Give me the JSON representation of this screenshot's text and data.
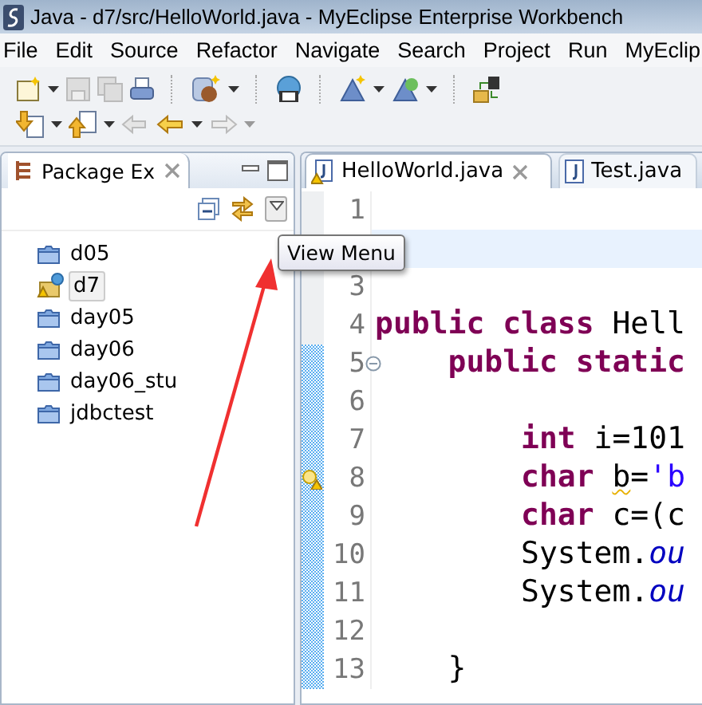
{
  "window": {
    "title": "Java - d7/src/HelloWorld.java - MyEclipse Enterprise Workbench"
  },
  "menu": [
    "File",
    "Edit",
    "Source",
    "Refactor",
    "Navigate",
    "Search",
    "Project",
    "Run",
    "MyEclip"
  ],
  "package_explorer": {
    "title": "Package Ex",
    "items": [
      {
        "label": "d05",
        "kind": "folder",
        "selected": false
      },
      {
        "label": "d7",
        "kind": "project",
        "selected": true
      },
      {
        "label": "day05",
        "kind": "folder",
        "selected": false
      },
      {
        "label": "day06",
        "kind": "folder",
        "selected": false
      },
      {
        "label": "day06_stu",
        "kind": "folder",
        "selected": false
      },
      {
        "label": "jdbctest",
        "kind": "folder",
        "selected": false
      }
    ]
  },
  "tooltip": "View Menu",
  "editor": {
    "tabs": [
      {
        "label": "HelloWorld.java",
        "selected": true,
        "warning": true
      },
      {
        "label": "Test.java",
        "selected": false,
        "warning": false
      }
    ],
    "lines": [
      {
        "number": "1",
        "current": false,
        "changed": false,
        "fold": false,
        "warning": false
      },
      {
        "current": true,
        "changed": false,
        "fold": false,
        "warning": false
      },
      {
        "number": "3",
        "current": false,
        "changed": false,
        "fold": false,
        "warning": false
      },
      {
        "number": "4",
        "current": false,
        "changed": false,
        "fold": false,
        "warning": false,
        "segments": [
          {
            "kind": "keyword",
            "text": "public class"
          },
          {
            "kind": "plain",
            "text": " Hell"
          }
        ]
      },
      {
        "number": "5",
        "current": false,
        "changed": true,
        "fold": true,
        "warning": false,
        "segments": [
          {
            "kind": "keyword",
            "text": "    public static"
          }
        ]
      },
      {
        "number": "6",
        "current": false,
        "changed": true,
        "fold": false,
        "warning": false
      },
      {
        "number": "7",
        "current": false,
        "changed": true,
        "fold": false,
        "warning": false,
        "segments": [
          {
            "kind": "keyword",
            "text": "        int"
          },
          {
            "kind": "plain",
            "text": " i=101"
          }
        ]
      },
      {
        "number": "8",
        "current": false,
        "changed": true,
        "fold": false,
        "warning": true,
        "segments": [
          {
            "kind": "keyword",
            "text": "        char "
          },
          {
            "kind": "warned",
            "text": "b"
          },
          {
            "kind": "plain",
            "text": "="
          },
          {
            "kind": "string",
            "text": "'b"
          }
        ]
      },
      {
        "number": "9",
        "current": false,
        "changed": true,
        "fold": false,
        "warning": false,
        "segments": [
          {
            "kind": "keyword",
            "text": "        char"
          },
          {
            "kind": "plain",
            "text": " c=(c"
          }
        ]
      },
      {
        "number": "10",
        "current": false,
        "changed": true,
        "fold": false,
        "warning": false,
        "segments": [
          {
            "kind": "plain",
            "text": "        System."
          },
          {
            "kind": "field",
            "text": "ou"
          }
        ]
      },
      {
        "number": "11",
        "current": false,
        "changed": true,
        "fold": false,
        "warning": false,
        "segments": [
          {
            "kind": "plain",
            "text": "        System."
          },
          {
            "kind": "field",
            "text": "ou"
          }
        ]
      },
      {
        "number": "12",
        "current": false,
        "changed": true,
        "fold": false,
        "warning": false
      },
      {
        "number": "13",
        "current": false,
        "changed": true,
        "fold": false,
        "warning": false,
        "segments": [
          {
            "kind": "plain",
            "text": "    }"
          }
        ]
      }
    ]
  }
}
